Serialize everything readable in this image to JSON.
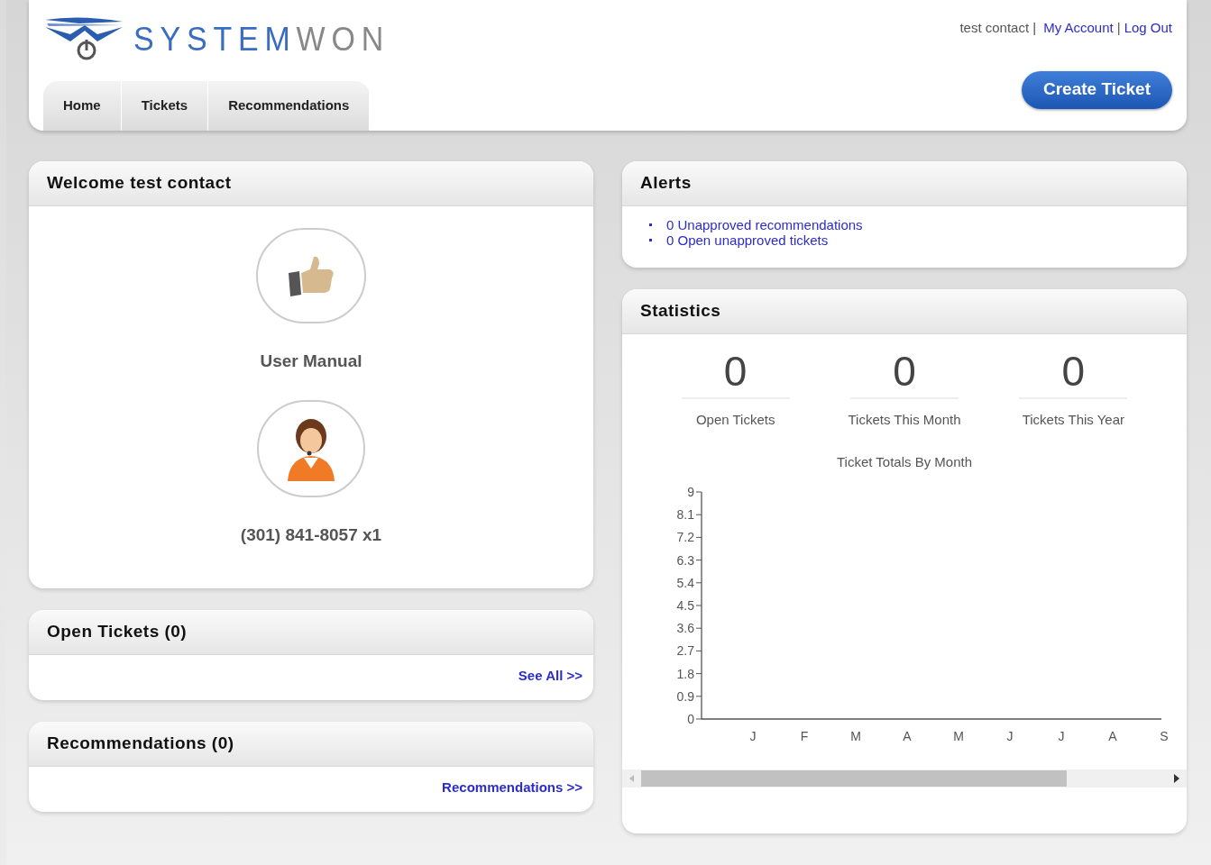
{
  "logo": {
    "part_1": "SYSTEM",
    "part_2": "WON"
  },
  "user_links": {
    "user": "test contact |",
    "account": "My Account",
    "separator": "|",
    "logout": "Log Out"
  },
  "tabs": [
    {
      "label": "Home",
      "selected": false
    },
    {
      "label": "Tickets",
      "selected": false
    },
    {
      "label": "Recommendations",
      "selected": false
    }
  ],
  "create_button": "Create Ticket",
  "welcome": {
    "title": "Welcome test contact",
    "manual_label": "User Manual",
    "phone": "(301) 841-8057 x1"
  },
  "open_tickets": {
    "title": "Open Tickets (0)",
    "link": "See All >>"
  },
  "recommendations": {
    "title": "Recommendations (0)",
    "link": "Recommendations >>"
  },
  "alerts": {
    "title": "Alerts",
    "items": [
      "0 Unapproved recommendations",
      "0 Open unapproved tickets"
    ]
  },
  "statistics": {
    "title": "Statistics",
    "stats": [
      {
        "value": "0",
        "label": "Open Tickets"
      },
      {
        "value": "0",
        "label": "Tickets This Month"
      },
      {
        "value": "0",
        "label": "Tickets This Year"
      }
    ],
    "chart_data": {
      "type": "bar",
      "title": "Ticket Totals By Month",
      "categories": [
        "J",
        "F",
        "M",
        "A",
        "M",
        "J",
        "J",
        "A",
        "S"
      ],
      "values": [
        0,
        0,
        0,
        0,
        0,
        0,
        0,
        0,
        0
      ],
      "ylim": [
        0,
        9
      ],
      "yticks": [
        0,
        {
          "value": 0.9,
          "label": "0.9"
        },
        {
          "value": 1.8,
          "label": "1.8"
        },
        {
          "value": 2.7,
          "label": "2.7"
        },
        {
          "value": 3.6,
          "label": "3.6"
        },
        {
          "value": 4.5,
          "label": "4.5"
        },
        {
          "value": 5.4,
          "label": "5.4"
        },
        {
          "value": 6.3,
          "label": "6.3"
        },
        {
          "value": 7.2,
          "label": "7.2"
        },
        {
          "value": 8.1,
          "label": "8.1"
        },
        9
      ]
    }
  }
}
